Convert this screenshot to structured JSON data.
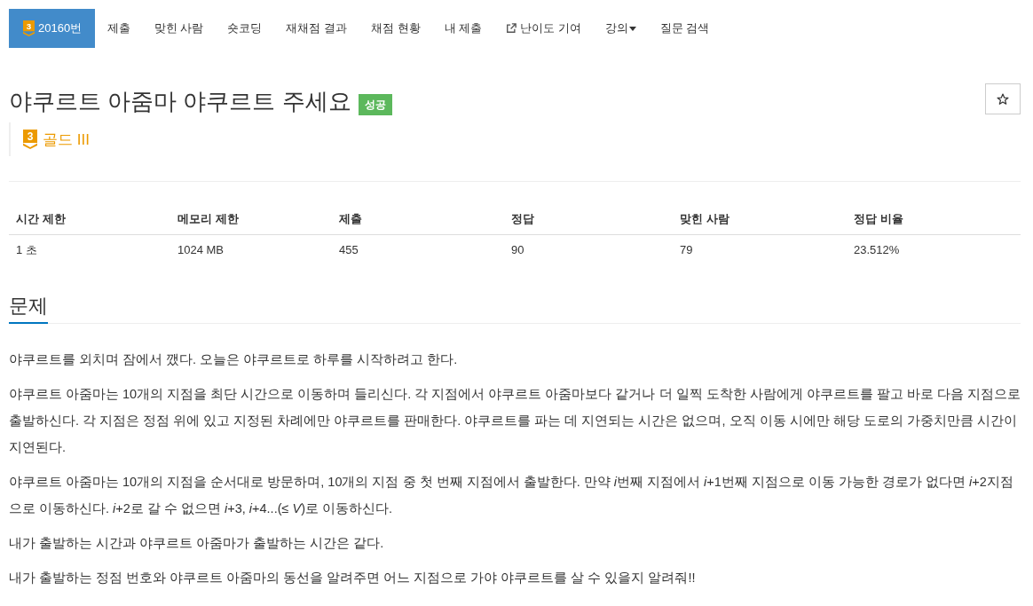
{
  "nav": {
    "tabs": [
      {
        "kind": "problem",
        "badge": "3",
        "label": "20160번",
        "selected": true
      },
      {
        "kind": "link",
        "label": "제출",
        "selected": false
      },
      {
        "kind": "link",
        "label": "맞힌 사람",
        "selected": false
      },
      {
        "kind": "link",
        "label": "숏코딩",
        "selected": false
      },
      {
        "kind": "link",
        "label": "재채점 결과",
        "selected": false
      },
      {
        "kind": "link",
        "label": "채점 현황",
        "selected": false
      },
      {
        "kind": "link",
        "label": "내 제출",
        "selected": false
      },
      {
        "kind": "external",
        "label": "난이도 기여",
        "selected": false
      },
      {
        "kind": "dropdown",
        "label": "강의",
        "selected": false
      },
      {
        "kind": "link",
        "label": "질문 검색",
        "selected": false
      }
    ]
  },
  "problem": {
    "title": "야쿠르트 아줌마 야쿠르트 주세요",
    "status": "성공",
    "starred": false,
    "tier": {
      "badge": "3",
      "label": "골드 III"
    }
  },
  "limits": {
    "columns": [
      "시간 제한",
      "메모리 제한",
      "제출",
      "정답",
      "맞힌 사람",
      "정답 비율"
    ],
    "rows": [
      [
        "1 초",
        "1024 MB",
        "455",
        "90",
        "79",
        "23.512%"
      ]
    ]
  },
  "description": {
    "heading": "문제",
    "paragraphs": [
      [
        {
          "text": "야쿠르트를 외치며 잠에서 깼다. 오늘은 야쿠르트로 하루를 시작하려고 한다.",
          "italic": false
        }
      ],
      [
        {
          "text": "야쿠르트 아줌마는 10개의 지점을 최단 시간으로 이동하며 들리신다. 각 지점에서 야쿠르트 아줌마보다 같거나 더 일찍 도착한 사람에게 야쿠르트를 팔고 바로 다음 지점으로 출발하신다. 각 지점은 정점 위에 있고 지정된 차례에만 야쿠르트를 판매한다. 야쿠르트를 파는 데 지연되는 시간은 없으며, 오직 이동 시에만 해당 도로의 가중치만큼 시간이 지연된다.",
          "italic": false
        }
      ],
      [
        {
          "text": "야쿠르트 아줌마는 10개의 지점을 순서대로 방문하며, 10개의 지점 중 첫 번째 지점에서 출발한다. 만약 ",
          "italic": false
        },
        {
          "text": "i",
          "italic": true
        },
        {
          "text": "번째 지점에서 ",
          "italic": false
        },
        {
          "text": "i",
          "italic": true
        },
        {
          "text": "+1번째 지점으로 이동 가능한 경로가 없다면 ",
          "italic": false
        },
        {
          "text": "i",
          "italic": true
        },
        {
          "text": "+2지점으로 이동하신다. ",
          "italic": false
        },
        {
          "text": "i",
          "italic": true
        },
        {
          "text": "+2로 갈 수 없으면 ",
          "italic": false
        },
        {
          "text": "i",
          "italic": true
        },
        {
          "text": "+3, ",
          "italic": false
        },
        {
          "text": "i",
          "italic": true
        },
        {
          "text": "+4...(≤ ",
          "italic": false
        },
        {
          "text": "V",
          "italic": true
        },
        {
          "text": ")로 이동하신다.",
          "italic": false
        }
      ],
      [
        {
          "text": "내가 출발하는 시간과 야쿠르트 아줌마가 출발하는 시간은 같다.",
          "italic": false
        }
      ],
      [
        {
          "text": "내가 출발하는 정점 번호와 야쿠르트 아줌마의 동선을 알려주면 어느 지점으로 가야 야쿠르트를 살 수 있을지 알려줘!!",
          "italic": false
        }
      ]
    ]
  }
}
